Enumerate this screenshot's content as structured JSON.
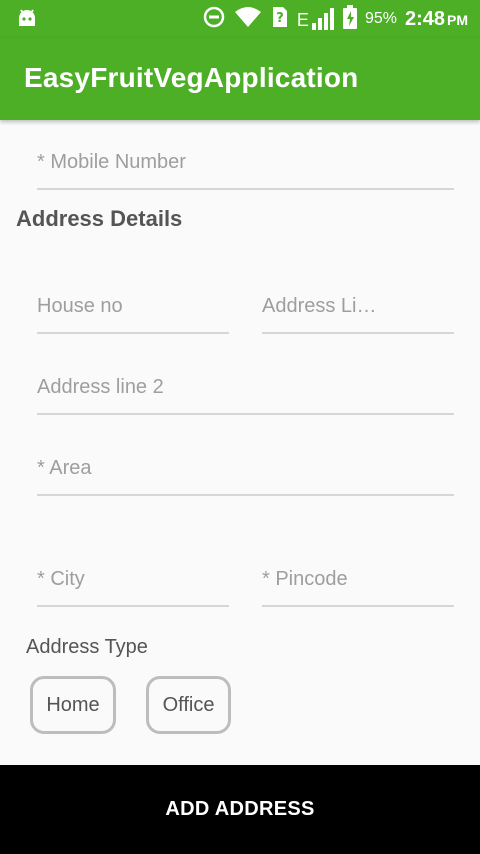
{
  "status_bar": {
    "battery_percent": "95%",
    "time": "2:48",
    "ampm": "PM",
    "network_label": "E",
    "icons": [
      "android-icon",
      "do-not-disturb-icon",
      "wifi-icon",
      "no-sim-icon",
      "signal-icon",
      "battery-charging-icon"
    ]
  },
  "app_bar": {
    "title": "EasyFruitVegApplication",
    "color": "#4caf26"
  },
  "form": {
    "mobile_placeholder": "* Mobile Number",
    "section_title": "Address Details",
    "house_no_placeholder": "House no",
    "address_line1_placeholder": "Address Li…",
    "address_line2_placeholder": "Address line 2",
    "area_placeholder": "* Area",
    "city_placeholder": "* City",
    "pincode_placeholder": "* Pincode",
    "address_type_title": "Address Type",
    "address_types": [
      "Home",
      "Office"
    ]
  },
  "footer": {
    "button_label": "ADD ADDRESS"
  }
}
